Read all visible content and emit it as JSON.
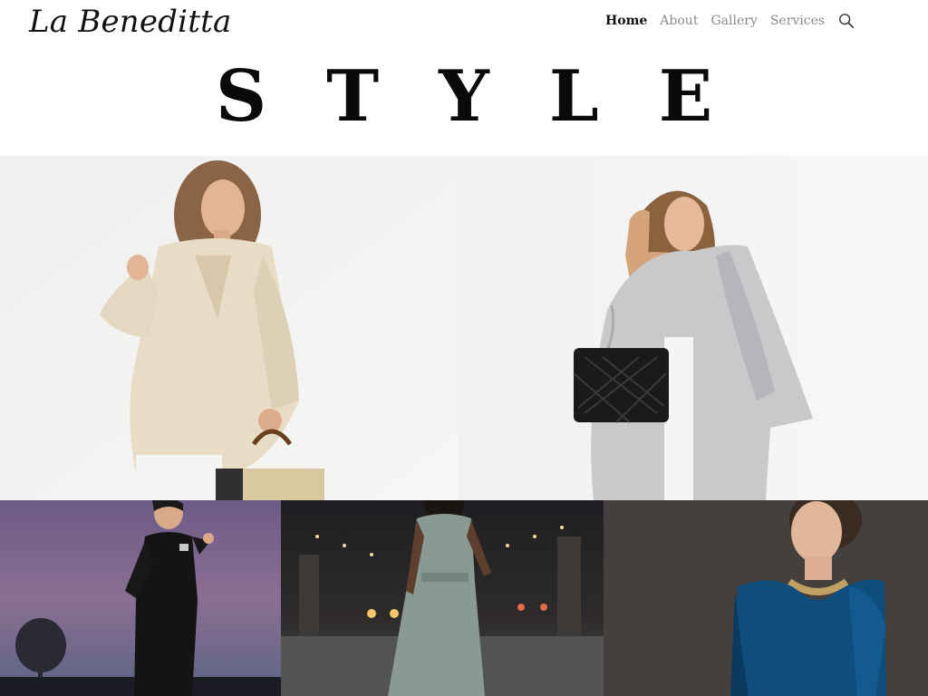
{
  "brand": {
    "logo_text": "La Beneditta"
  },
  "nav": {
    "items": [
      {
        "label": "Home",
        "active": true
      },
      {
        "label": "About",
        "active": false
      },
      {
        "label": "Gallery",
        "active": false
      },
      {
        "label": "Services",
        "active": false
      }
    ],
    "search_icon": "search-icon"
  },
  "hero": {
    "title": "STYLE"
  },
  "gallery": {
    "photos": [
      {
        "subject": "woman in cream teddy coat holding a handbag"
      },
      {
        "subject": "woman in grey wool coat with black quilted bag"
      },
      {
        "subject": "woman in black blazer dress at dusk"
      },
      {
        "subject": "woman in sage green jumpsuit in urban tunnel"
      },
      {
        "subject": "woman in blue velvet top with gold chain necklace"
      }
    ]
  },
  "colors": {
    "nav_active": "#111111",
    "nav_inactive": "#8a8a8a",
    "background": "#ffffff"
  }
}
